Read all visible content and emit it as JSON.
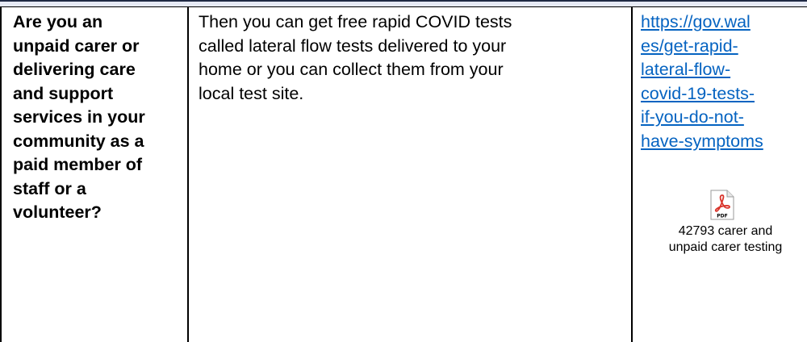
{
  "row": {
    "question_lines": [
      "Are you an",
      "unpaid carer or",
      "delivering care",
      "and support",
      "services in your",
      "community as a",
      "paid member of",
      "staff or a",
      "volunteer?"
    ],
    "answer_lines": [
      "Then you can get free rapid COVID tests",
      "called lateral flow tests delivered to your",
      "home or you can collect them from your",
      "local test site."
    ],
    "link_lines": [
      "https://gov.wal",
      "es/get-rapid-",
      "lateral-flow-",
      "covid-19-tests-",
      "if-you-do-not-",
      "have-symptoms"
    ],
    "attachment": {
      "icon": "pdf-icon",
      "icon_label": "PDF",
      "caption_lines": [
        "42793 carer and",
        "unpaid carer testing"
      ]
    }
  },
  "colors": {
    "link": "#0563c1",
    "pdf_red": "#d9342b",
    "header_band": "#e6eaf5"
  }
}
